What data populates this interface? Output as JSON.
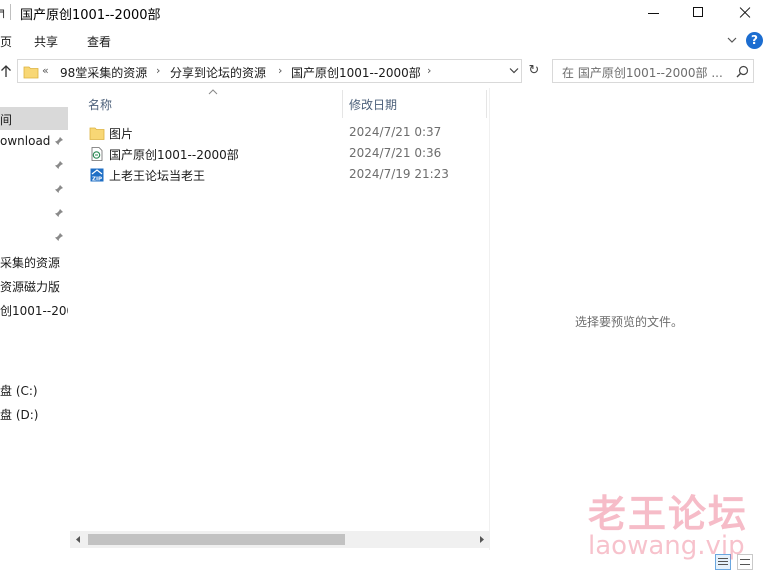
{
  "window": {
    "title": "国产原创1001--2000部",
    "left_glyph": "╕"
  },
  "ribbon": {
    "tabs": [
      "页",
      "共享",
      "查看"
    ],
    "help_label": "?"
  },
  "address": {
    "overflow": "«",
    "crumbs": [
      "98堂采集的资源",
      "分享到论坛的资源",
      "国产原创1001--2000部"
    ],
    "separator": "›",
    "refresh_glyph": "↻"
  },
  "search": {
    "placeholder": "在 国产原创1001--2000部 ..."
  },
  "nav": {
    "items": [
      {
        "label": "间",
        "pinned": false,
        "selected": true
      },
      {
        "label": "ownload",
        "pinned": true,
        "selected": false
      },
      {
        "label": "",
        "pinned": true,
        "selected": false
      },
      {
        "label": "",
        "pinned": true,
        "selected": false
      },
      {
        "label": "",
        "pinned": true,
        "selected": false
      },
      {
        "label": "",
        "pinned": true,
        "selected": false
      },
      {
        "label": "采集的资源",
        "pinned": false,
        "selected": false
      },
      {
        "label": "资源磁力版",
        "pinned": false,
        "selected": false
      },
      {
        "label": "创1001--200",
        "pinned": false,
        "selected": false
      },
      {
        "label": "盘 (C:)",
        "pinned": false,
        "selected": false
      },
      {
        "label": "盘 (D:)",
        "pinned": false,
        "selected": false
      }
    ]
  },
  "list": {
    "columns": {
      "name": "名称",
      "date": "修改日期"
    },
    "rows": [
      {
        "name": "图片",
        "date": "2024/7/21 0:37",
        "icon": "folder-icon"
      },
      {
        "name": "国产原创1001--2000部",
        "date": "2024/7/21 0:36",
        "icon": "text-file-icon"
      },
      {
        "name": "上老王论坛当老王",
        "date": "2024/7/19 21:23",
        "icon": "zip-file-icon"
      }
    ]
  },
  "preview": {
    "message": "选择要预览的文件。"
  },
  "watermark": {
    "title": "老王论坛",
    "url": "laowang.vip"
  },
  "colors": {
    "accent": "#1c6dd0",
    "folder": "#f8d775",
    "watermark": "#e8506e"
  }
}
